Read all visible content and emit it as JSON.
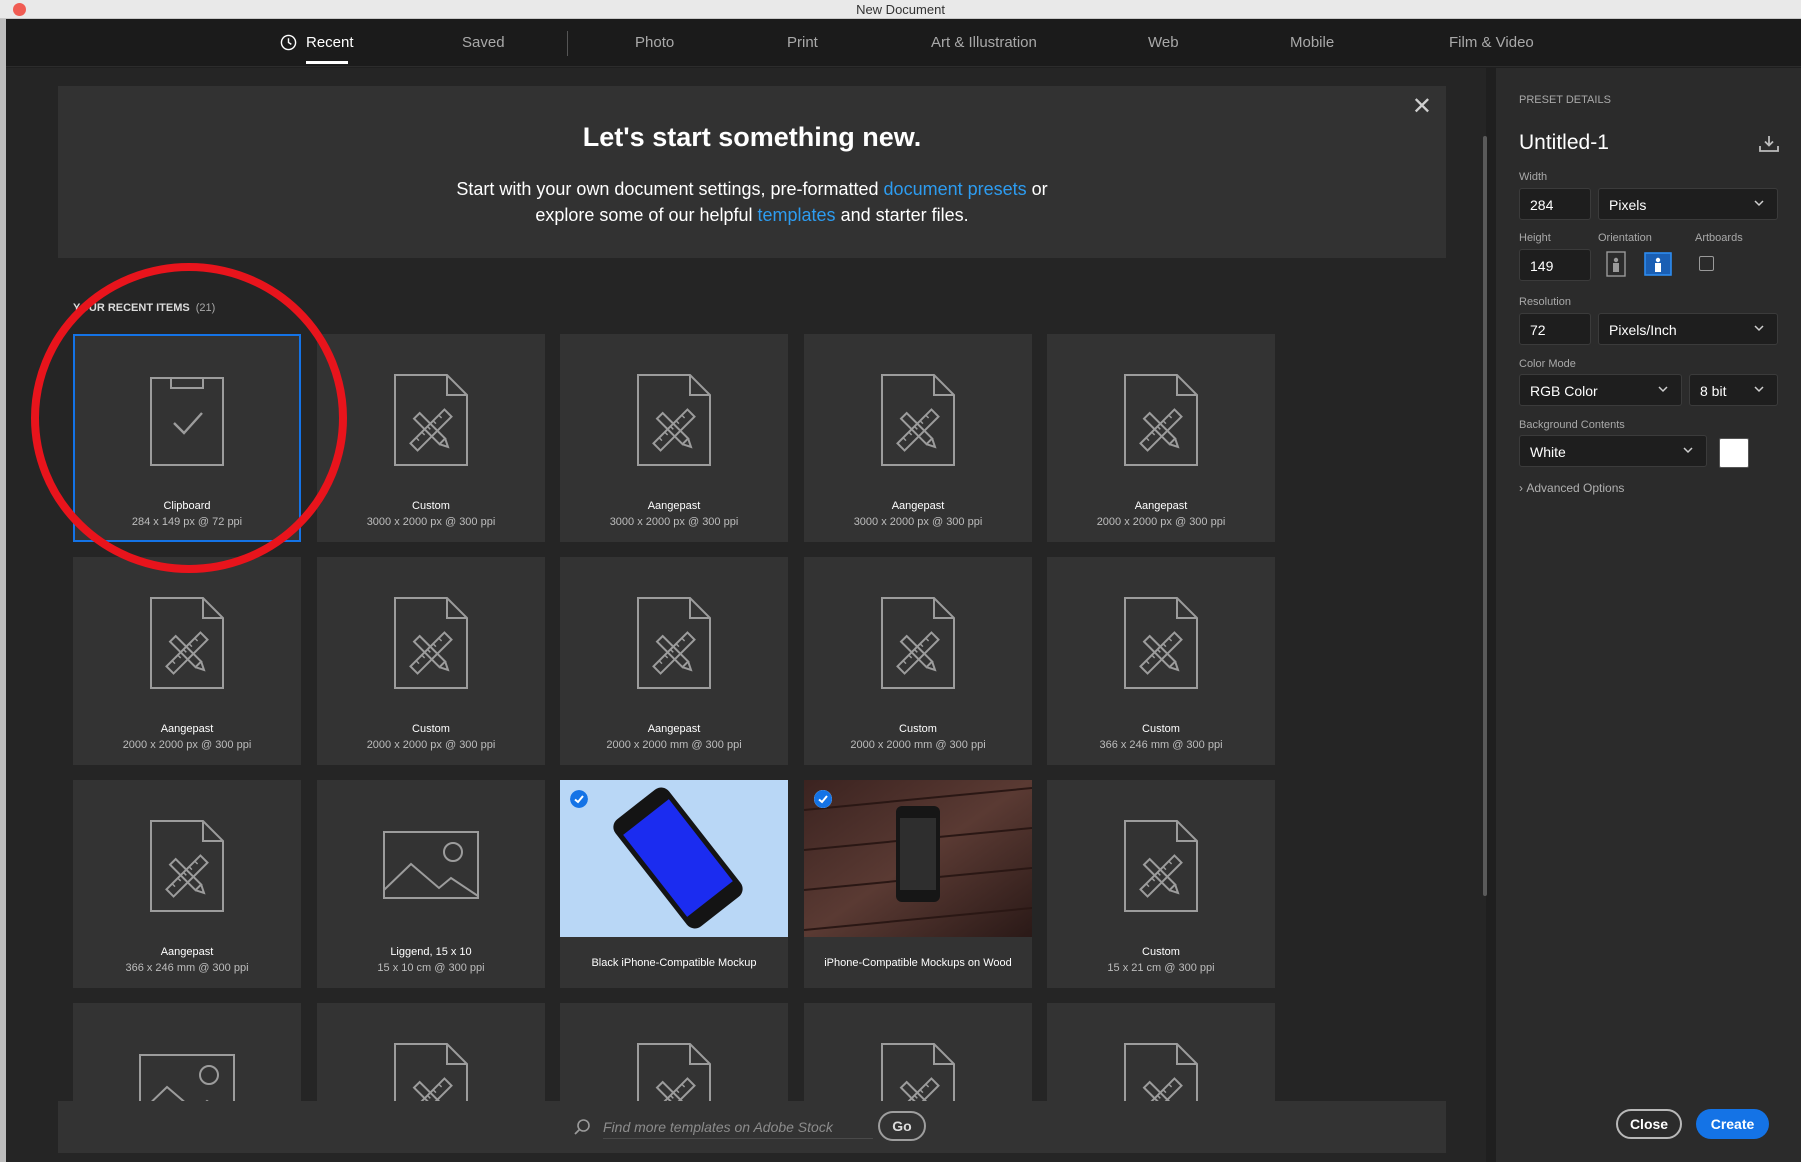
{
  "window": {
    "title": "New Document"
  },
  "tabs": [
    {
      "label": "Recent",
      "active": true,
      "icon": "clock-icon"
    },
    {
      "label": "Saved"
    },
    {
      "label": "Photo"
    },
    {
      "label": "Print"
    },
    {
      "label": "Art & Illustration"
    },
    {
      "label": "Web"
    },
    {
      "label": "Mobile"
    },
    {
      "label": "Film & Video"
    }
  ],
  "banner": {
    "headline": "Let's start something new.",
    "line1_a": "Start with your own document settings, pre-formatted ",
    "line1_link": "document presets",
    "line1_b": " or",
    "line2_a": "explore some of our helpful ",
    "line2_link": "templates",
    "line2_b": " and starter files.",
    "close_icon": "close-icon",
    "link_color": "#2d9cf0"
  },
  "recent": {
    "heading": "YOUR RECENT ITEMS",
    "count": "(21)",
    "items": [
      {
        "name": "Clipboard",
        "size": "284 x 149 px @ 72 ppi",
        "icon": "clipboard-icon",
        "selected": true
      },
      {
        "name": "Custom",
        "size": "3000 x 2000 px @ 300 ppi",
        "icon": "document-tools-icon"
      },
      {
        "name": "Aangepast",
        "size": "3000 x 2000 px @ 300 ppi",
        "icon": "document-tools-icon"
      },
      {
        "name": "Aangepast",
        "size": "3000 x 2000 px @ 300 ppi",
        "icon": "document-tools-icon"
      },
      {
        "name": "Aangepast",
        "size": "2000 x 2000 px @ 300 ppi",
        "icon": "document-tools-icon"
      },
      {
        "name": "Aangepast",
        "size": "2000 x 2000 px @ 300 ppi",
        "icon": "document-tools-icon"
      },
      {
        "name": "Custom",
        "size": "2000 x 2000 px @ 300 ppi",
        "icon": "document-tools-icon"
      },
      {
        "name": "Aangepast",
        "size": "2000 x 2000 mm @ 300 ppi",
        "icon": "document-tools-icon"
      },
      {
        "name": "Custom",
        "size": "2000 x 2000 mm @ 300 ppi",
        "icon": "document-tools-icon"
      },
      {
        "name": "Custom",
        "size": "366 x 246 mm @ 300 ppi",
        "icon": "document-tools-icon"
      },
      {
        "name": "Aangepast",
        "size": "366 x 246 mm @ 300 ppi",
        "icon": "document-tools-icon"
      },
      {
        "name": "Liggend, 15 x 10",
        "size": "15 x 10 cm @ 300 ppi",
        "icon": "image-icon"
      },
      {
        "name": "Black iPhone-Compatible Mockup",
        "size": "",
        "icon": "phone-mockup-thumbnail",
        "template": true
      },
      {
        "name": "iPhone-Compatible Mockups on Wood",
        "size": "",
        "icon": "wood-mockup-thumbnail",
        "template": true
      },
      {
        "name": "Custom",
        "size": "15 x 21 cm @ 300 ppi",
        "icon": "document-tools-icon"
      },
      {
        "name": "",
        "size": "",
        "icon": "image-icon"
      },
      {
        "name": "",
        "size": "",
        "icon": "document-tools-icon"
      },
      {
        "name": "",
        "size": "",
        "icon": "document-tools-icon"
      },
      {
        "name": "",
        "size": "",
        "icon": "document-tools-icon"
      },
      {
        "name": "",
        "size": "",
        "icon": "document-tools-icon"
      }
    ]
  },
  "search": {
    "placeholder": "Find more templates on Adobe Stock",
    "go_label": "Go",
    "icon": "search-icon"
  },
  "preset": {
    "section_label": "PRESET DETAILS",
    "doc_name": "Untitled-1",
    "save_icon": "save-preset-icon",
    "width_label": "Width",
    "width_value": "284",
    "width_unit": "Pixels",
    "height_label": "Height",
    "height_value": "149",
    "orientation_label": "Orientation",
    "orientation_selected": "landscape",
    "artboards_label": "Artboards",
    "artboards_checked": false,
    "resolution_label": "Resolution",
    "resolution_value": "72",
    "resolution_unit": "Pixels/Inch",
    "color_mode_label": "Color Mode",
    "color_mode": "RGB Color",
    "bit_depth": "8 bit",
    "bg_label": "Background Contents",
    "bg_value": "White",
    "advanced": "Advanced Options",
    "close_label": "Close",
    "create_label": "Create",
    "accent": "#1473e6"
  },
  "annotation": {
    "color": "#e8141c",
    "shape": "circle-around-clipboard"
  }
}
